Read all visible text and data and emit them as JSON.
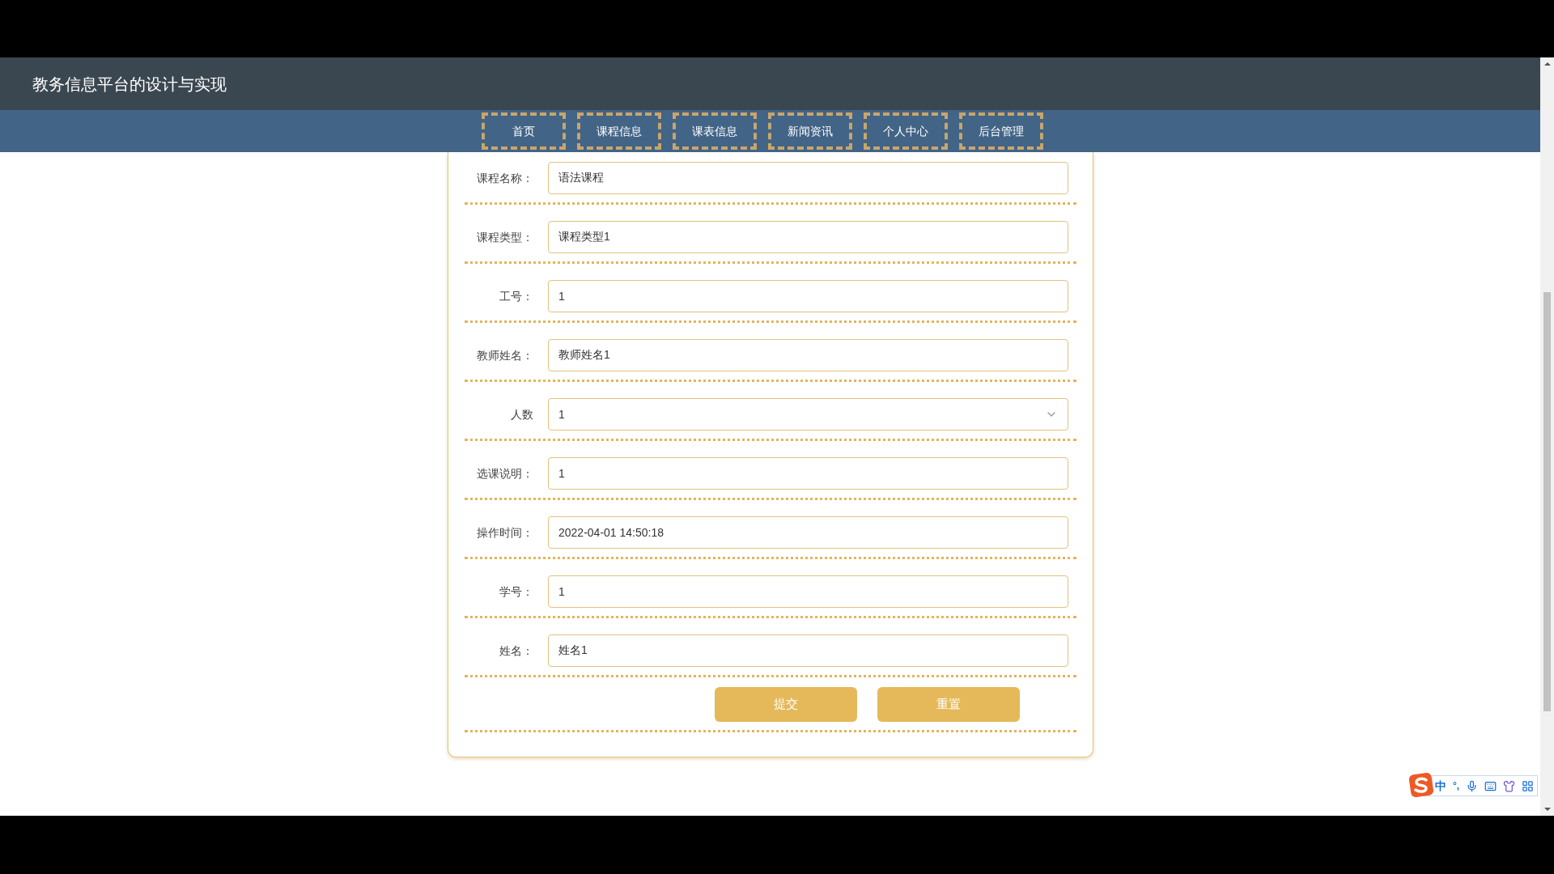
{
  "header": {
    "title": "教务信息平台的设计与实现"
  },
  "nav": [
    {
      "label": "首页"
    },
    {
      "label": "课程信息"
    },
    {
      "label": "课表信息"
    },
    {
      "label": "新闻资讯"
    },
    {
      "label": "个人中心"
    },
    {
      "label": "后台管理"
    }
  ],
  "form": {
    "fields": [
      {
        "label": "课程名称：",
        "value": "语法课程",
        "kind": "text"
      },
      {
        "label": "课程类型：",
        "value": "课程类型1",
        "kind": "text"
      },
      {
        "label": "工号：",
        "value": "1",
        "kind": "text"
      },
      {
        "label": "教师姓名：",
        "value": "教师姓名1",
        "kind": "text"
      },
      {
        "label": "人数",
        "value": "1",
        "kind": "select"
      },
      {
        "label": "选课说明：",
        "value": "1",
        "kind": "text"
      },
      {
        "label": "操作时间：",
        "value": "2022-04-01 14:50:18",
        "kind": "text"
      },
      {
        "label": "学号：",
        "value": "1",
        "kind": "text"
      },
      {
        "label": "姓名：",
        "value": "姓名1",
        "kind": "text"
      }
    ],
    "buttons": [
      "提交",
      "重置"
    ]
  },
  "ime_toolbar": {
    "mode": "中",
    "punctuation": "°,"
  }
}
